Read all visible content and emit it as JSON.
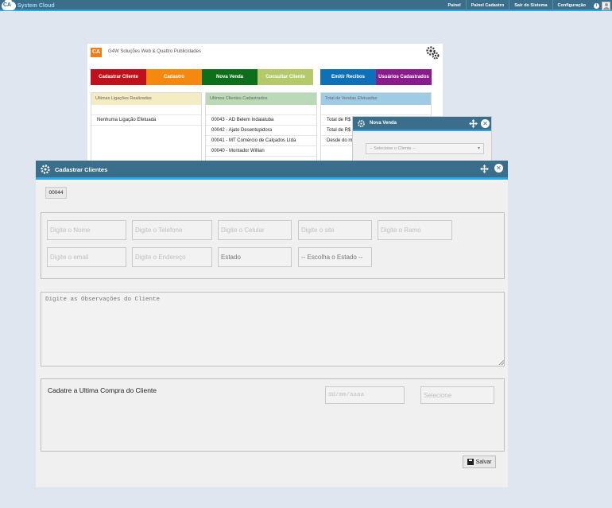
{
  "topbar": {
    "brand_mark": "CA",
    "brand_text": "System Cloud",
    "nav": [
      "Painel",
      "Painel Cadastro",
      "Sair do Sistema",
      "Configuração"
    ],
    "info_glyph": "i"
  },
  "dashboard": {
    "logo_text": "CA",
    "company": "G4W Soluções Web & Quattro Publicidades",
    "buttons": [
      {
        "label": "Cadastrar Cliente",
        "color": "#c0101c"
      },
      {
        "label": "Cadastro",
        "color": "#f5890f"
      },
      {
        "label": "Nova Venda",
        "color": "#0d6f1c"
      },
      {
        "label": "Consultar Cliente",
        "color": "#b5c96b"
      },
      {
        "label": "Emitir Recibos",
        "color": "#0e71b8"
      },
      {
        "label": "Usuários Cadastrados",
        "color": "#8a1b8c"
      }
    ],
    "columns": [
      {
        "title": "Ultimas Ligações Realizadas",
        "color": "#f4ecc2",
        "items": [
          "",
          "Nenhuma Ligação Efetuada"
        ]
      },
      {
        "title": "Ultimos Clientes Cadastrados",
        "color": "#b9d9b7",
        "items": [
          "",
          "00043 - AD Belem Indaiatuba",
          "00042 - Ajato Desentupidora",
          "00041 - MT Comércio de Calçados Ltda",
          "00040 - Montador Willian"
        ]
      },
      {
        "title": "Total de Vendas Efetuadas",
        "color": "#9fcbe4",
        "items": [
          "",
          "Total de R$",
          "Total de R$",
          "Desde do m"
        ]
      }
    ]
  },
  "nova_venda": {
    "title": "Nova Venda",
    "select_placeholder": "-- Selecione o Cliente --",
    "close_glyph": "✕"
  },
  "dialog": {
    "title": "Cadastrar Clientes",
    "close_glyph": "✕",
    "code": "00044",
    "fields": {
      "nome": "Digite o Nome",
      "telefone": "Digite o Telefone",
      "celular": "Digite o Celular",
      "site": "Digite o site",
      "ramo": "Digite o Ramo",
      "email": "Digite o email",
      "endereco": "Digite o Endereço",
      "estado": "Estado",
      "escolha_estado": "-- Escolha o Estado --"
    },
    "observacoes_placeholder": "Digite as Observações do Cliente",
    "compra_label": "Cadatre a Ultima Compra do Cliente",
    "date_placeholder": "dd/mm/aaaa",
    "selecione_placeholder": "Selecione",
    "save_label": "Salvar"
  }
}
